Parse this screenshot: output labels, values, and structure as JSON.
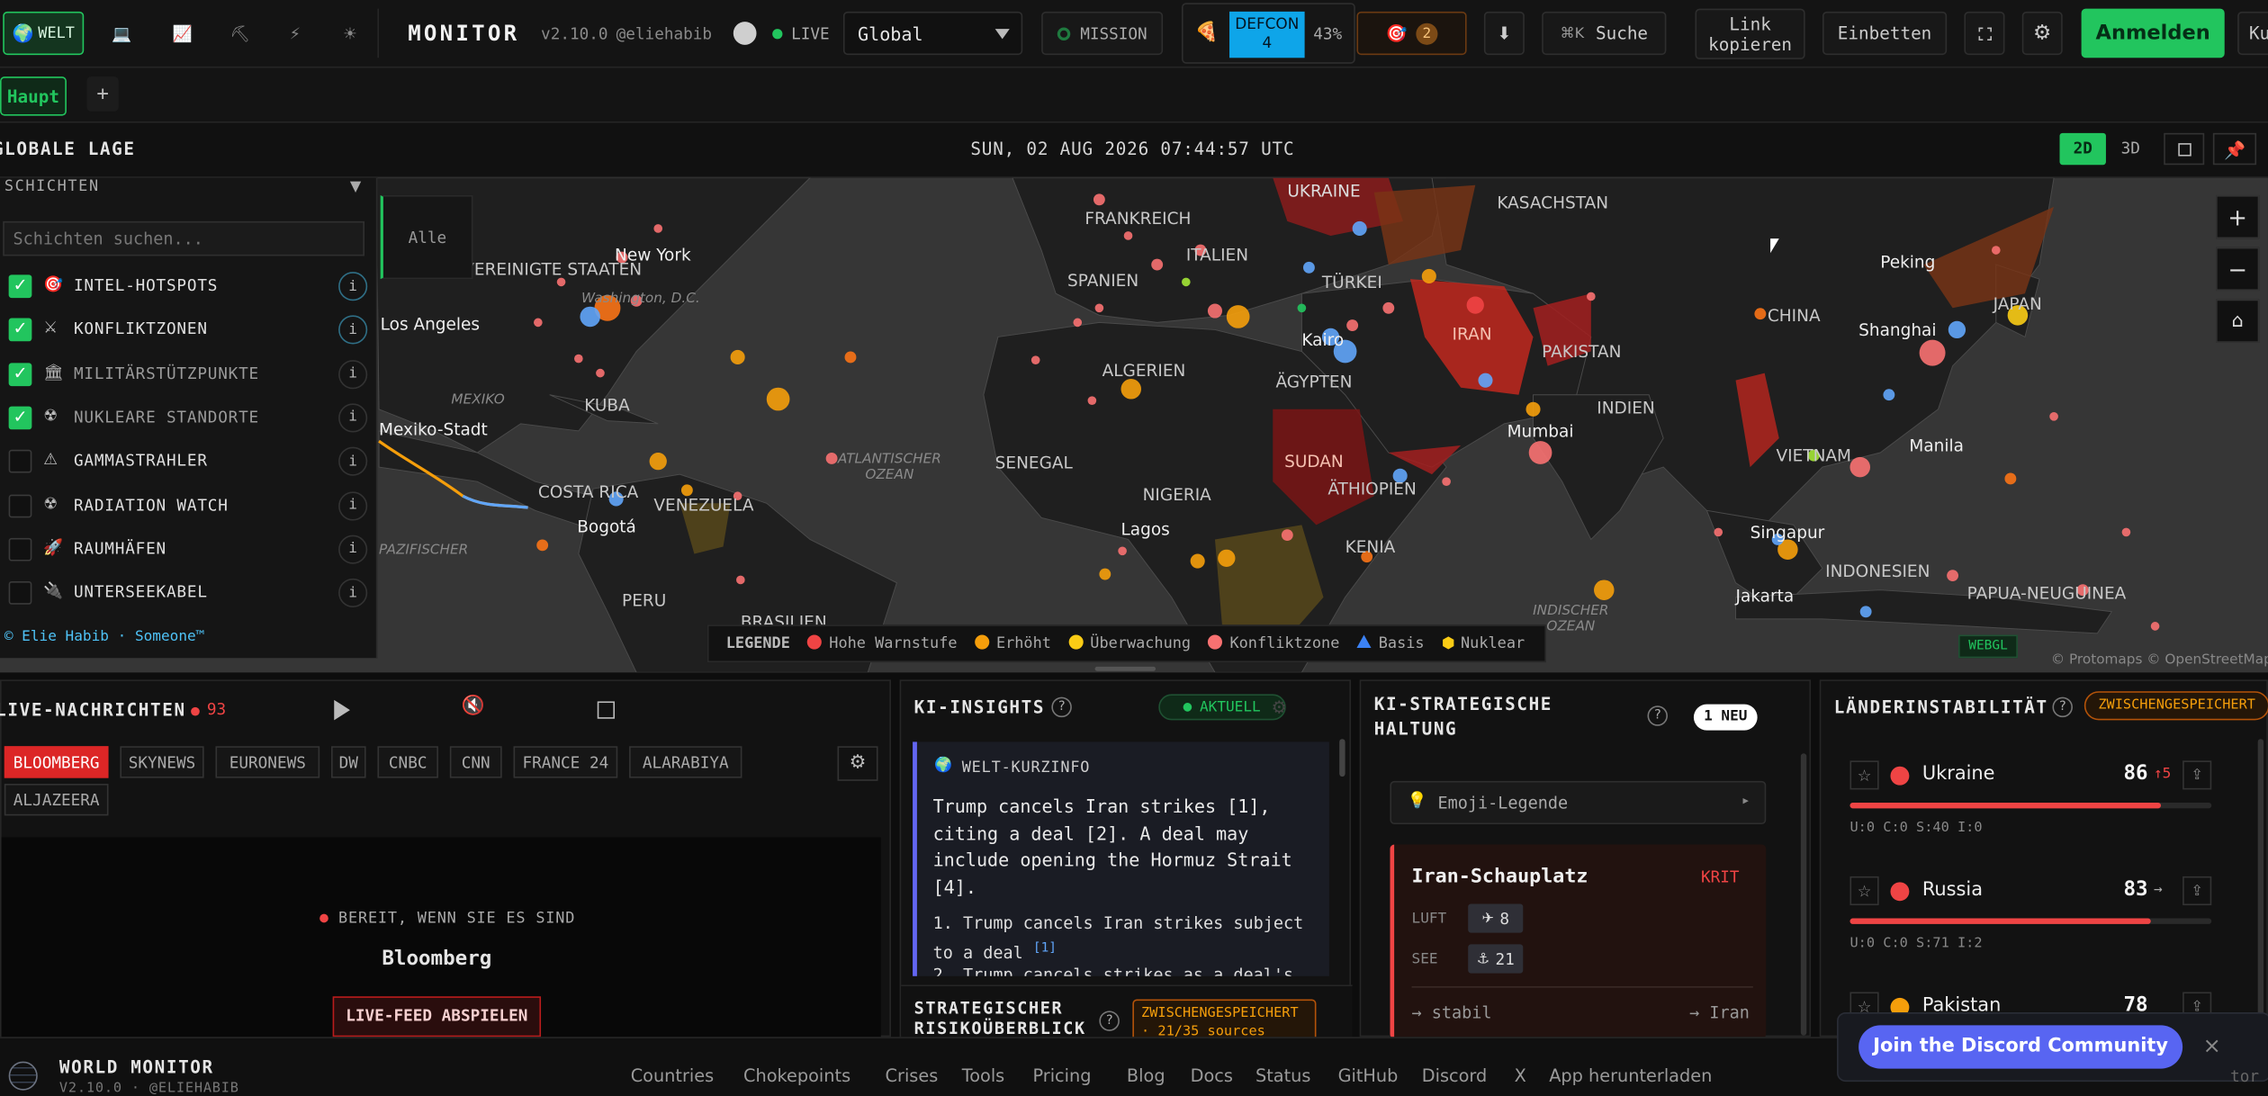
{
  "topbar": {
    "variant_tabs": [
      {
        "label": "WELT",
        "icon": "globe-icon"
      },
      {
        "label": "",
        "icon": "laptop-icon"
      },
      {
        "label": "",
        "icon": "chart-icon"
      },
      {
        "label": "",
        "icon": "pickaxe-icon"
      },
      {
        "label": "",
        "icon": "bolt-icon"
      },
      {
        "label": "",
        "icon": "sun-icon"
      }
    ],
    "app_title": "MONITOR",
    "version": "v2.10.0",
    "handle": "@eliehabib",
    "live_label": "LIVE",
    "region_select": "Global",
    "mission_label": "MISSION",
    "defcon_label": "DEFCON",
    "defcon_level": "4",
    "defcon_pct": "43%",
    "alerts_count": "2",
    "search_shortcut": "⌘K",
    "search_label": "Suche",
    "copy_link_label": "Link kopieren",
    "embed_label": "Einbetten",
    "signin_label": "Anmelden",
    "cut_label": "Ku"
  },
  "tabs": {
    "main_tab": "Haupt",
    "add_tab": "+"
  },
  "lage": {
    "title": "GLOBALE LAGE",
    "datetime": "SUN, 02 AUG 2026 07:44:57 UTC",
    "mode_2d": "2D",
    "mode_3d": "3D"
  },
  "layers": {
    "title": "SCHICHTEN",
    "search_placeholder": "Schichten suchen...",
    "all_label": "Alle",
    "items": [
      {
        "label": "INTEL-HOTSPOTS",
        "checked": true,
        "icon": "target-icon"
      },
      {
        "label": "KONFLIKTZONEN",
        "checked": true,
        "icon": "swords-icon"
      },
      {
        "label": "MILITÄRSTÜTZPUNKTE",
        "checked": true,
        "icon": "building-icon"
      },
      {
        "label": "NUKLEARE STANDORTE",
        "checked": true,
        "icon": "radiation-icon"
      },
      {
        "label": "GAMMASTRAHLER",
        "checked": false,
        "icon": "warning-icon"
      },
      {
        "label": "RADIATION WATCH",
        "checked": false,
        "icon": "radiation-icon"
      },
      {
        "label": "RAUMHÄFEN",
        "checked": false,
        "icon": "rocket-icon"
      },
      {
        "label": "UNTERSEEKABEL",
        "checked": false,
        "icon": "plug-icon"
      }
    ],
    "credit": "© Elie Habib · Someone™"
  },
  "map": {
    "labels": [
      "UKRAINE",
      "KASACHSTAN",
      "FRANKREICH",
      "ITALIEN",
      "SPANIEN",
      "TÜRKEI",
      "IRAN",
      "PAKISTAN",
      "CHINA",
      "Peking",
      "Shanghai",
      "JAPAN",
      "New York",
      "VEREINIGTE STAATEN",
      "Washington, D.C.",
      "Los Angeles",
      "MEXIKO",
      "Mexiko-Stadt",
      "KUBA",
      "ALGERIEN",
      "ÄGYPTEN",
      "Kairo",
      "INDIEN",
      "Mumbai",
      "SUDAN",
      "ÄTHIOPIEN",
      "SENEGAL",
      "NIGERIA",
      "Lagos",
      "KENIA",
      "COSTA RICA",
      "VENEZUELA",
      "Bogotá",
      "PERU",
      "BRASILIEN",
      "ATLANTISCHER OZEAN",
      "INDISCHER OZEAN",
      "VIETNAM",
      "Manila",
      "Singapur",
      "Jakarta",
      "INDONESIEN",
      "PAPUA-NEUGUINEA",
      "PAZIFISCHER"
    ],
    "webgl": "WEBGL",
    "attribution": "© Protomaps © OpenStreetMap"
  },
  "legend": {
    "title": "LEGENDE",
    "items": [
      {
        "label": "Hohe Warnstufe",
        "color": "#ef4444"
      },
      {
        "label": "Erhöht",
        "color": "#f59e0b"
      },
      {
        "label": "Überwachung",
        "color": "#facc15"
      },
      {
        "label": "Konfliktzone",
        "color": "#ef4444"
      },
      {
        "label": "Basis",
        "color": "#3b82f6"
      },
      {
        "label": "Nuklear",
        "color": "#facc15"
      }
    ]
  },
  "news": {
    "title": "LIVE-NACHRICHTEN",
    "count": "93",
    "channels": [
      "BLOOMBERG",
      "SKYNEWS",
      "EURONEWS",
      "DW",
      "CNBC",
      "CNN",
      "FRANCE 24",
      "ALARABIYA",
      "ALJAZEERA"
    ],
    "ready": "BEREIT, WENN SIE ES SIND",
    "channel": "Bloomberg",
    "play_label": "LIVE-FEED ABSPIELEN"
  },
  "insights": {
    "title": "KI-INSIGHTS",
    "status": "AKTUELL",
    "brief_title": "WELT-KURZINFO",
    "brief_text": "Trump cancels Iran strikes [1], citing a deal [2]. A deal may include opening the Hormuz Strait [4].",
    "item1": "Trump cancels Iran strikes subject to a deal",
    "item1_ref": "[1]",
    "item2": "Trump cancels strikes as a deal's",
    "risk_title": "STRATEGISCHER RISIKOÜBERBLICK",
    "risk_badge": "ZWISCHENGESPEICHERT · 21/35 sources"
  },
  "posture": {
    "title": "KI-STRATEGISCHE HALTUNG",
    "new_badge": "1 NEU",
    "emoji_legend": "Emoji-Legende",
    "theater": "Iran-Schauplatz",
    "level": "KRIT",
    "air_label": "LUFT",
    "air_value": "8",
    "sea_label": "SEE",
    "sea_value": "21",
    "trend": "→ stabil",
    "target": "→ Iran"
  },
  "instability": {
    "title": "LÄNDERINSTABILITÄT",
    "badge": "ZWISCHENGESPEICHERT",
    "rows": [
      {
        "country": "Ukraine",
        "score": "86",
        "delta": "↑5",
        "stats": "U:0 C:0 S:40 I:0",
        "fill": 0.86
      },
      {
        "country": "Russia",
        "score": "83",
        "delta": "→",
        "stats": "U:0 C:0 S:71 I:2",
        "fill": 0.83
      },
      {
        "country": "Pakistan",
        "score": "78",
        "delta": "",
        "stats": "",
        "fill": 0.78
      }
    ]
  },
  "footer": {
    "brand": "WORLD MONITOR",
    "version": "V2.10.0 · @ELIEHABIB",
    "links": [
      "Countries",
      "Chokepoints",
      "Crises",
      "Tools",
      "Pricing",
      "Blog",
      "Docs",
      "Status",
      "GitHub",
      "Discord",
      "X",
      "App herunterladen"
    ],
    "discord_cta": "Join the Discord Community",
    "close": "×",
    "tail": "tor"
  },
  "colors": {
    "accent": "#22c55e",
    "alert": "#ef4444",
    "warn": "#f59e0b",
    "defcon_bg": "#0ea5e9",
    "discord": "#5865f2"
  }
}
